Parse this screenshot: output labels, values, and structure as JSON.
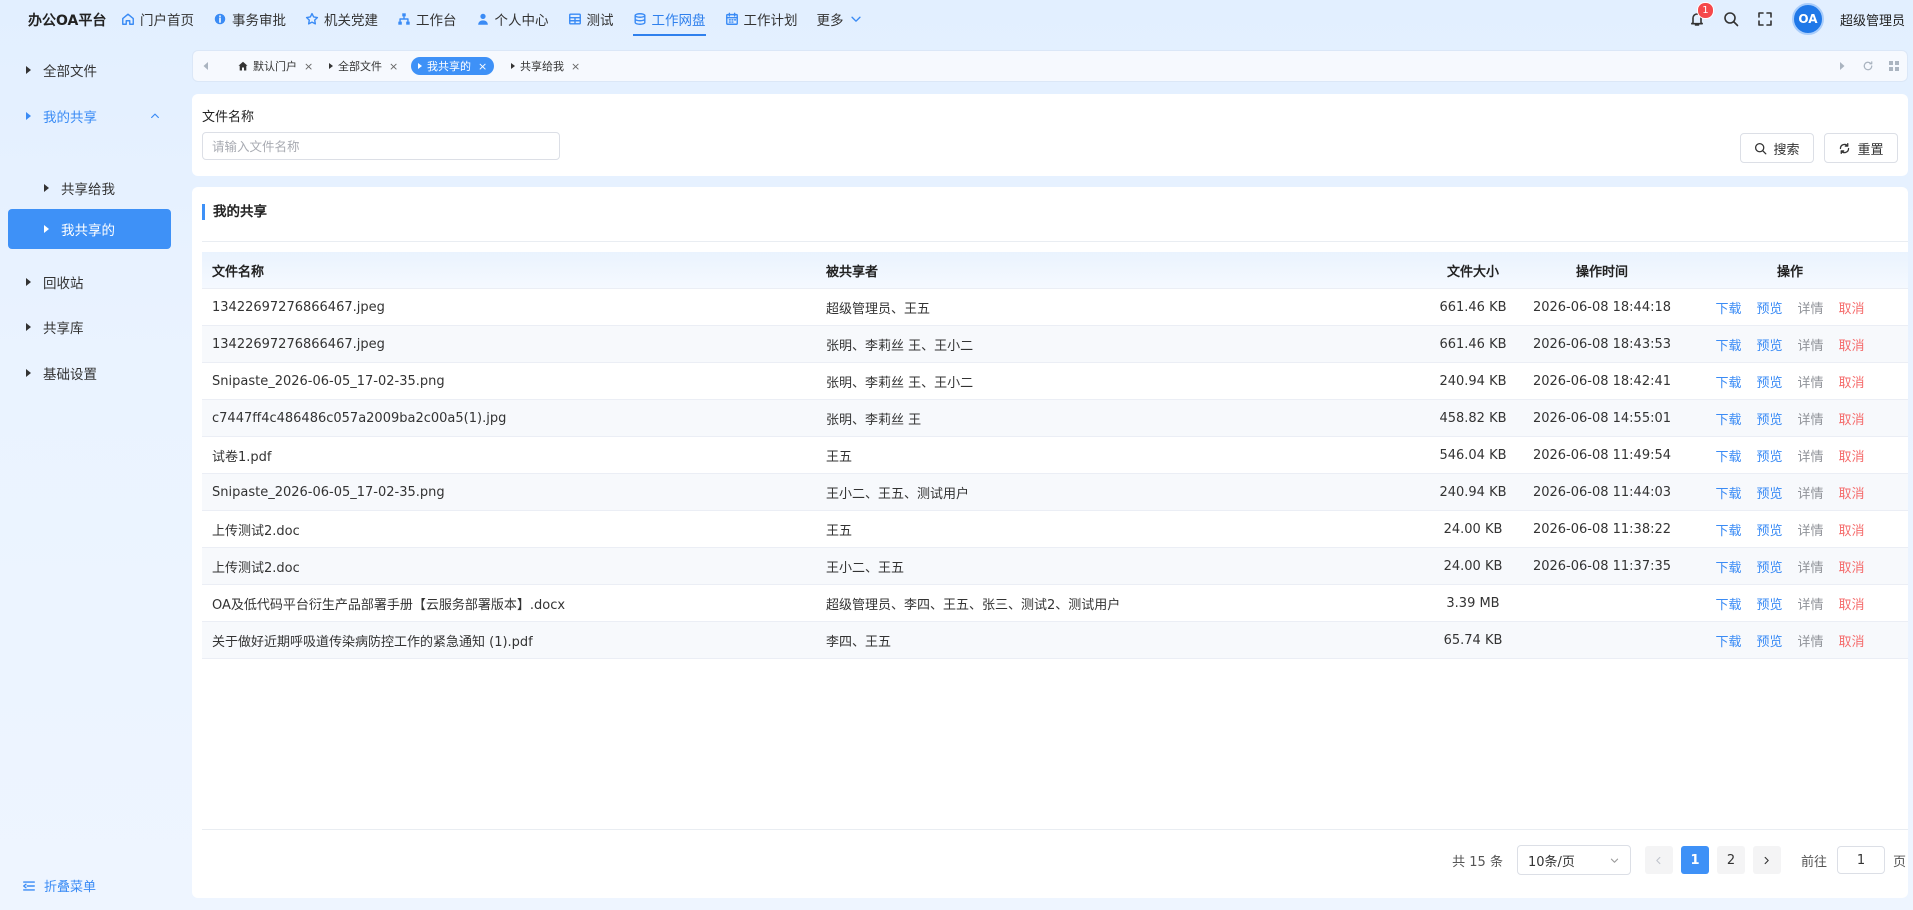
{
  "app": {
    "brand": "办公OA平台",
    "username": "超级管理员",
    "avatar_text": "OA",
    "notification_count": "1"
  },
  "nav": [
    {
      "label": "门户首页",
      "icon": "home-icon"
    },
    {
      "label": "事务审批",
      "icon": "info-icon"
    },
    {
      "label": "机关党建",
      "icon": "star-icon"
    },
    {
      "label": "工作台",
      "icon": "org-chart-icon"
    },
    {
      "label": "个人中心",
      "icon": "user-icon"
    },
    {
      "label": "测试",
      "icon": "grid-icon"
    },
    {
      "label": "工作网盘",
      "icon": "database-icon"
    },
    {
      "label": "工作计划",
      "icon": "calendar-icon"
    },
    {
      "label": "更多",
      "icon": "chevron-down-icon"
    }
  ],
  "sidebar": {
    "items": [
      {
        "label": "全部文件"
      },
      {
        "label": "我的共享"
      },
      {
        "label": "共享给我"
      },
      {
        "label": "我共享的"
      },
      {
        "label": "回收站"
      },
      {
        "label": "共享库"
      },
      {
        "label": "基础设置"
      }
    ],
    "collapse_label": "折叠菜单"
  },
  "tabs": [
    {
      "label": "默认门户"
    },
    {
      "label": "全部文件"
    },
    {
      "label": "我共享的"
    },
    {
      "label": "共享给我"
    }
  ],
  "search": {
    "label": "文件名称",
    "placeholder": "请输入文件名称",
    "value": "",
    "search_button": "搜索",
    "reset_button": "重置"
  },
  "panel": {
    "title": "我的共享"
  },
  "table": {
    "columns": {
      "name": "文件名称",
      "sharer": "被共享者",
      "size": "文件大小",
      "time": "操作时间",
      "ops": "操作"
    },
    "op_labels": {
      "download": "下载",
      "preview": "预览",
      "detail": "详情",
      "cancel": "取消"
    },
    "rows": [
      {
        "name": "13422697276866467.jpeg",
        "sharer": "超级管理员、王五",
        "size": "661.46 KB",
        "time": "2026-06-08 18:44:18"
      },
      {
        "name": "13422697276866467.jpeg",
        "sharer": "张明、李莉丝 王、王小二",
        "size": "661.46 KB",
        "time": "2026-06-08 18:43:53"
      },
      {
        "name": "Snipaste_2026-06-05_17-02-35.png",
        "sharer": "张明、李莉丝 王、王小二",
        "size": "240.94 KB",
        "time": "2026-06-08 18:42:41"
      },
      {
        "name": "c7447ff4c486486c057a2009ba2c00a5(1).jpg",
        "sharer": "张明、李莉丝 王",
        "size": "458.82 KB",
        "time": "2026-06-08 14:55:01"
      },
      {
        "name": "试卷1.pdf",
        "sharer": "王五",
        "size": "546.04 KB",
        "time": "2026-06-08 11:49:54"
      },
      {
        "name": "Snipaste_2026-06-05_17-02-35.png",
        "sharer": "王小二、王五、测试用户",
        "size": "240.94 KB",
        "time": "2026-06-08 11:44:03"
      },
      {
        "name": "上传测试2.doc",
        "sharer": "王五",
        "size": "24.00 KB",
        "time": "2026-06-08 11:38:22"
      },
      {
        "name": "上传测试2.doc",
        "sharer": "王小二、王五",
        "size": "24.00 KB",
        "time": "2026-06-08 11:37:35"
      },
      {
        "name": "OA及低代码平台衍生产品部署手册【云服务部署版本】.docx",
        "sharer": "超级管理员、李四、王五、张三、测试2、测试用户",
        "size": "3.39 MB",
        "time": ""
      },
      {
        "name": "关于做好近期呼吸道传染病防控工作的紧急通知 (1).pdf",
        "sharer": "李四、王五",
        "size": "65.74 KB",
        "time": ""
      }
    ]
  },
  "pagination": {
    "total": "共 15 条",
    "page_size": "10条/页",
    "pages": [
      "1",
      "2"
    ],
    "goto_label": "前往",
    "goto_value": "1",
    "page_suffix": "页"
  },
  "colors": {
    "accent": "#3e91f7",
    "danger": "#f56c6c",
    "muted": "#909399",
    "badge": "#f5484b"
  }
}
